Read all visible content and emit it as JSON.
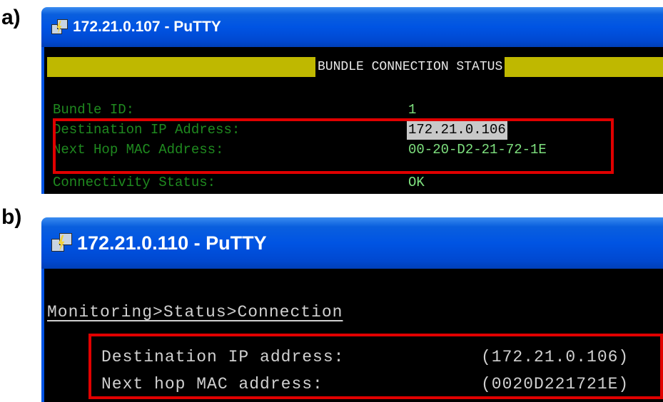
{
  "panel_labels": {
    "a": "a)",
    "b": "b)"
  },
  "window_a": {
    "title": "172.21.0.107 - PuTTY",
    "header": "BUNDLE CONNECTION STATUS",
    "rows": [
      {
        "label": "Bundle ID:",
        "value": "1"
      },
      {
        "label": "Destination IP Address:",
        "value": "172.21.0.106"
      },
      {
        "label": "Next Hop MAC Address:",
        "value": "00-20-D2-21-72-1E"
      },
      {
        "label": "Connectivity Status:",
        "value": "OK"
      }
    ]
  },
  "window_b": {
    "title": "172.21.0.110 - PuTTY",
    "breadcrumb": "Monitoring>Status>Connection",
    "rows": [
      {
        "label": "Destination IP address:",
        "value": "(172.21.0.106)"
      },
      {
        "label": "Next hop MAC address:",
        "value": "(0020D221721E)"
      }
    ]
  },
  "colors": {
    "titlebar": "#0054e3",
    "terminal_bg": "#000000",
    "header_bar": "#bfb800",
    "label_green": "#1f8a1f",
    "highlight_box": "#e00000"
  },
  "icons": [
    "putty-icon"
  ]
}
